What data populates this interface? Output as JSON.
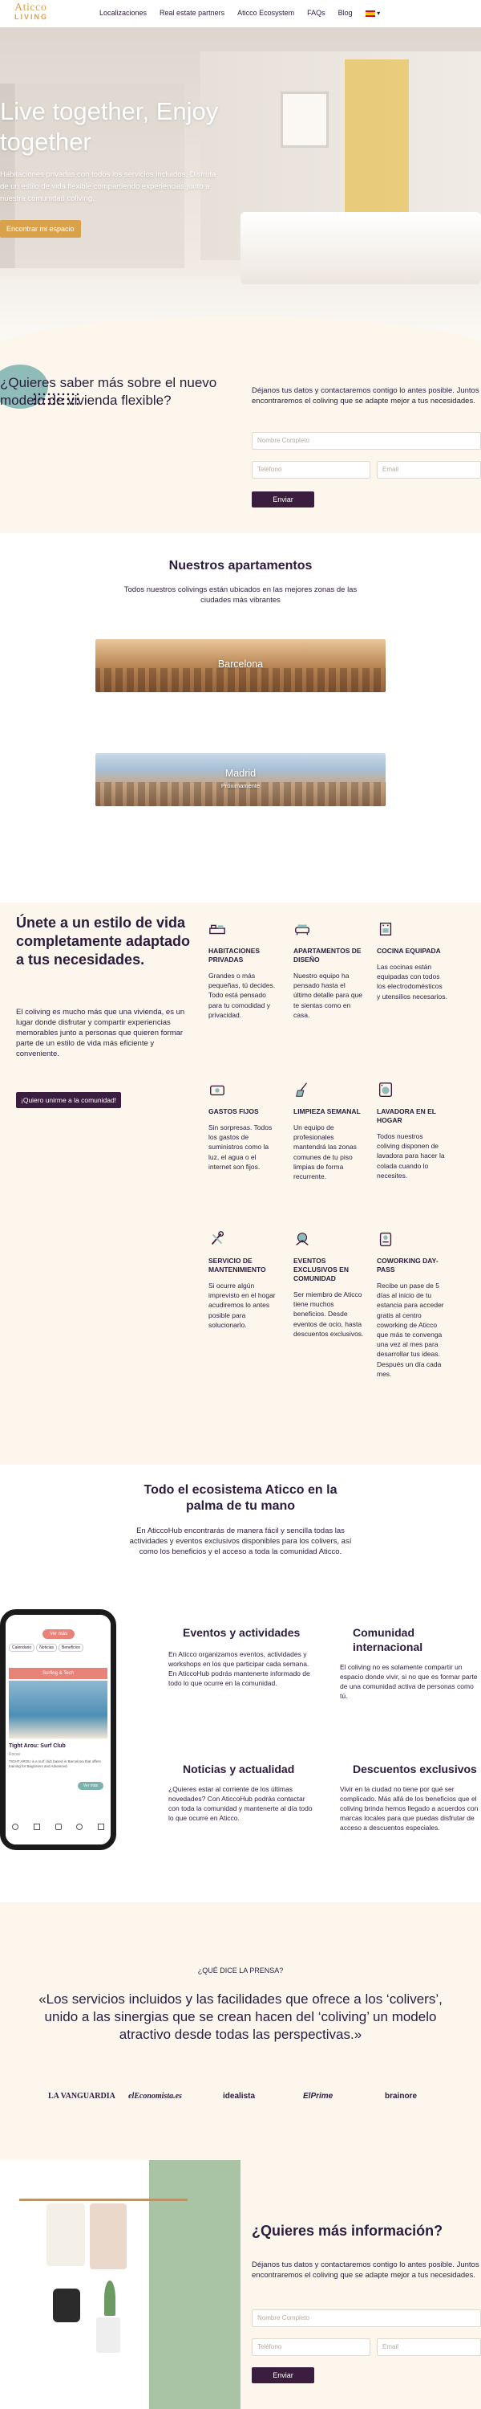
{
  "header": {
    "logo_line1": "Aticco",
    "logo_line2": "LIVING",
    "nav": [
      "Localizaciones",
      "Real estate partners",
      "Aticco Ecosystem",
      "FAQs",
      "Blog"
    ],
    "lang_caret": "▾"
  },
  "hero": {
    "title": "Live together, Enjoy together",
    "subtitle": "Habitaciones privadas con todos los servicios incluidos. Disfruta de un estilo de vida flexible compartiendo experiencias junto a nuestra comunidad coliving.",
    "cta": "Encontrar mi espacio"
  },
  "lead_form": {
    "title": "¿Quieres saber más sobre el nuevo modelo de vivienda flexible?",
    "description": "Déjanos tus datos y contactaremos contigo lo antes posible. Juntos encontraremos el coliving que se adapte mejor a tus necesidades.",
    "name_placeholder": "Nombre Completo",
    "phone_placeholder": "Teléfono",
    "email_placeholder": "Email",
    "submit": "Enviar"
  },
  "apartments": {
    "title": "Nuestros apartamentos",
    "subtitle": "Todos nuestros colivings están ubicados en las mejores zonas de las ciudades más vibrantes",
    "cities": [
      {
        "name": "Barcelona",
        "note": ""
      },
      {
        "name": "Madrid",
        "note": "Próximamente"
      }
    ]
  },
  "features": {
    "title": "Únete a un estilo de vida completamente adaptado a tus necesidades.",
    "intro": "El coliving es mucho más que una vivienda, es un lugar donde disfrutar y compartir experiencias memorables junto a personas que quieren formar parte de un estilo de vida más eficiente y conveniente.",
    "cta": "¡Quiero unirme a la comunidad!",
    "items": [
      {
        "icon": "bed-icon",
        "title": "HABITACIONES PRIVADAS",
        "text": "Grandes o más pequeñas, tú decides. Todo está pensado para tu comodidad y privacidad."
      },
      {
        "icon": "sofa-icon",
        "title": "APARTAMENTOS DE DISEÑO",
        "text": "Nuestro equipo ha pensado hasta el último detalle para que te sientas como en casa."
      },
      {
        "icon": "kitchen-icon",
        "title": "COCINA EQUIPADA",
        "text": "Las cocinas están equipadas con todos los electrodomésticos y utensilios necesarios."
      },
      {
        "icon": "wallet-icon",
        "title": "GASTOS FIJOS",
        "text": "Sin sorpresas. Todos los gastos de suministros como la luz, el agua o el internet son fijos."
      },
      {
        "icon": "broom-icon",
        "title": "LIMPIEZA SEMANAL",
        "text": "Un equipo de profesionales mantendrá las zonas comunes de tu piso limpias de forma recurrente."
      },
      {
        "icon": "washing-machine-icon",
        "title": "LAVADORA EN EL HOGAR",
        "text": "Todos nuestros coliving disponen de lavadora para hacer la colada cuando lo necesites."
      },
      {
        "icon": "tools-icon",
        "title": "SERVICIO DE MANTENIMIENTO",
        "text": "Si ocurre algún imprevisto en el hogar acudiremos lo antes posible para solucionarlo."
      },
      {
        "icon": "event-icon",
        "title": "EVENTOS EXCLUSIVOS EN COMUNIDAD",
        "text": "Ser miembro de Aticco tiene muchos beneficios. Desde eventos de ocio, hasta descuentos exclusivos."
      },
      {
        "icon": "badge-icon",
        "title": "COWORKING DAY-PASS",
        "text": "Recibe un pase de 5 días al inicio de tu estancia para acceder gratis al centro coworking de Aticco que más te convenga una vez al mes para desarrollar tus ideas. Después un día cada mes."
      }
    ]
  },
  "ecosystem": {
    "title": "Todo el ecosistema Aticco en la palma de tu mano",
    "intro": "En AticcoHub encontrarás de manera fácil y sencilla todas las actividades y eventos exclusivos disponibles para los colivers, así como los beneficios y el acceso a toda la comunidad Aticco.",
    "blocks": [
      {
        "title": "Eventos y actividades",
        "text": "En Aticco organizamos eventos, actividades y workshops en los que participar cada semana. En AticcoHub podrás mantenerte informado de todo lo que ocurre en la comunidad."
      },
      {
        "title": "Comunidad internacional",
        "text": "El coliving no es solamente compartir un espacio donde vivir, si no que es formar parte de una comunidad activa de personas como tú."
      },
      {
        "title": "Noticias y actualidad",
        "text": "¿Quieres estar al corriente de los últimas novedades? Con AticcoHub podrás contactar con toda la comunidad y mantenerte al día todo lo que ocurre en Aticco."
      },
      {
        "title": "Descuentos exclusivos",
        "text": "Vivir en la ciudad no tiene por qué ser complicado. Más allá de los beneficios que el coliving brinda hemos llegado a acuerdos con marcas locales para que puedas disfrutar de acceso a descuentos especiales."
      }
    ],
    "phone": {
      "pill": "Ver más",
      "tabs": [
        "Calendario",
        "Noticias",
        "Beneficios"
      ],
      "banner": "Surfing & Tech",
      "card_title": "Tight Arou: Surf Club",
      "card_meta": "Rocas",
      "card_text": "TIGHT AROU is a surf club based in Barcelona that offers training for Beginners and Advanced.",
      "card_btn": "Ver más"
    }
  },
  "press": {
    "kicker": "¿QUÉ DICE LA PRENSA?",
    "quote": "«Los servicios incluidos y las facilidades que ofrece a los ‘colivers’, unido a las sinergias que se crean hacen del ‘coliving’ un modelo atractivo desde todas las perspectivas.»",
    "logos": [
      "LA VANGUARDIA",
      "elEconomista.es",
      "idealista",
      "ElPrime",
      "brainore"
    ]
  },
  "more_info": {
    "title": "¿Quieres más información?",
    "description": "Déjanos tus datos y contactaremos contigo lo antes posible. Juntos encontraremos el coliving que se adapte mejor a tus necesidades.",
    "name_placeholder": "Nombre Completo",
    "phone_placeholder": "Teléfono",
    "email_placeholder": "Email",
    "submit": "Enviar"
  },
  "colors": {
    "brand_gold": "#d9a24a",
    "brand_purple": "#3b1d3f",
    "cream_bg": "#fdf6ec",
    "teal_accent": "#8fbcb9",
    "text": "#2d1b3d"
  }
}
